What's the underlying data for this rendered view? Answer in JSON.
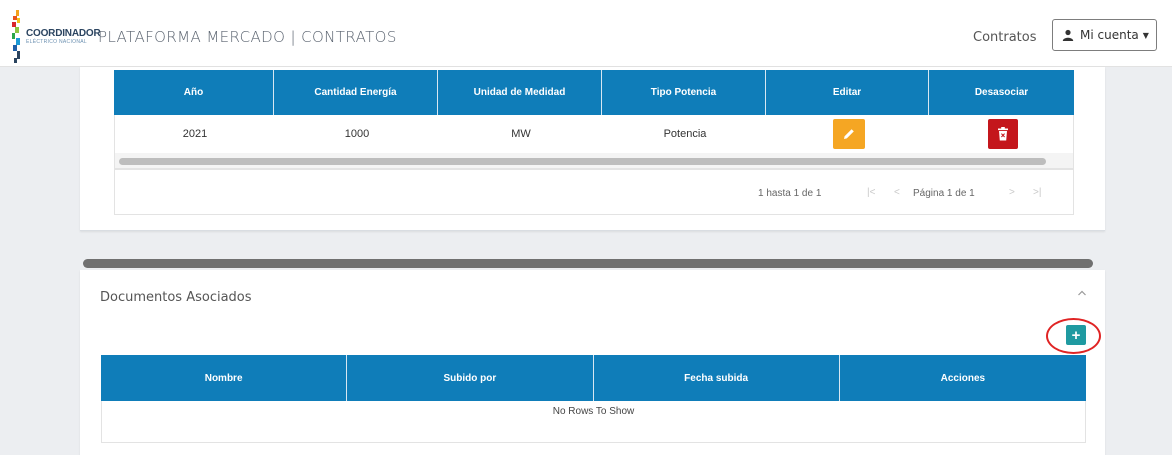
{
  "navbar": {
    "logo_main": "COORDINADOR",
    "logo_sub": "ELÉCTRICO NACIONAL",
    "title": "PLATAFORMA MERCADO | CONTRATOS",
    "link_contratos": "Contratos",
    "account_label": "Mi cuenta"
  },
  "energy_grid": {
    "columns": [
      "Año",
      "Cantidad Energía",
      "Unidad de Medidad",
      "Tipo Potencia",
      "Editar",
      "Desasociar"
    ],
    "rows": [
      {
        "anio": "2021",
        "cantidad": "1000",
        "unidad": "MW",
        "tipo": "Potencia"
      }
    ],
    "pager": {
      "info": "1 hasta 1 de 1",
      "page_label": "Página",
      "page_current": "1",
      "of_label": "de",
      "page_total": "1"
    }
  },
  "documents": {
    "title": "Documentos Asociados",
    "add_label": "+",
    "columns": [
      "Nombre",
      "Subido por",
      "Fecha subida",
      "Acciones"
    ],
    "empty_text": "No Rows To Show"
  },
  "colors": {
    "header_blue": "#0f7db9",
    "edit_orange": "#f5a623",
    "delete_red": "#c4161c",
    "add_teal": "#1f9aa1",
    "highlight_ring": "#e02424"
  }
}
